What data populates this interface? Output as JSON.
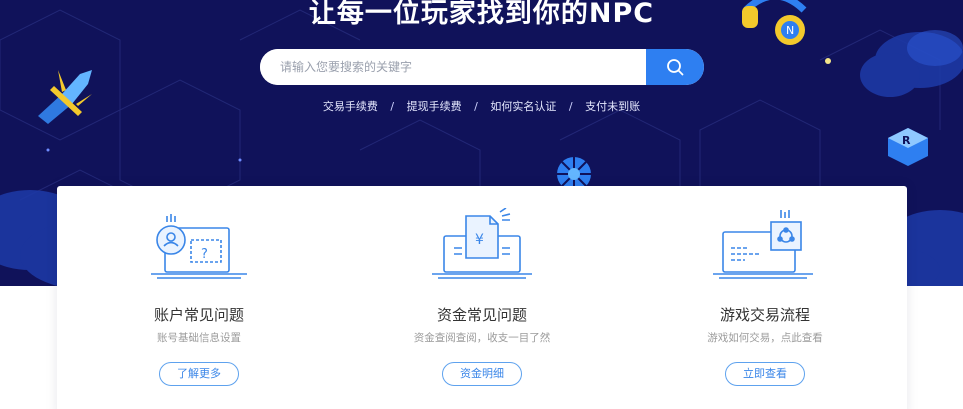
{
  "hero": {
    "headline": "让每一位玩家找到你的NPC",
    "search": {
      "placeholder": "请输入您要搜索的关键字",
      "icon": "search-icon"
    },
    "quick_links": [
      "交易手续费",
      "提现手续费",
      "如何实名认证",
      "支付未到账"
    ],
    "separator": "/"
  },
  "features": [
    {
      "title": "账户常见问题",
      "desc": "账号基础信息设置",
      "button": "了解更多",
      "icon": "account-help-icon"
    },
    {
      "title": "资金常见问题",
      "desc": "资金查阅查阅，收支一目了然",
      "button": "资金明细",
      "icon": "fund-icon"
    },
    {
      "title": "游戏交易流程",
      "desc": "游戏如何交易，点此查看",
      "button": "立即查看",
      "icon": "trade-flow-icon"
    }
  ],
  "colors": {
    "hero_bg": "#10125a",
    "accent": "#2e7ff1",
    "button_border": "#5ea2ee",
    "title_text": "#333333",
    "desc_text": "#9b9b9b"
  }
}
